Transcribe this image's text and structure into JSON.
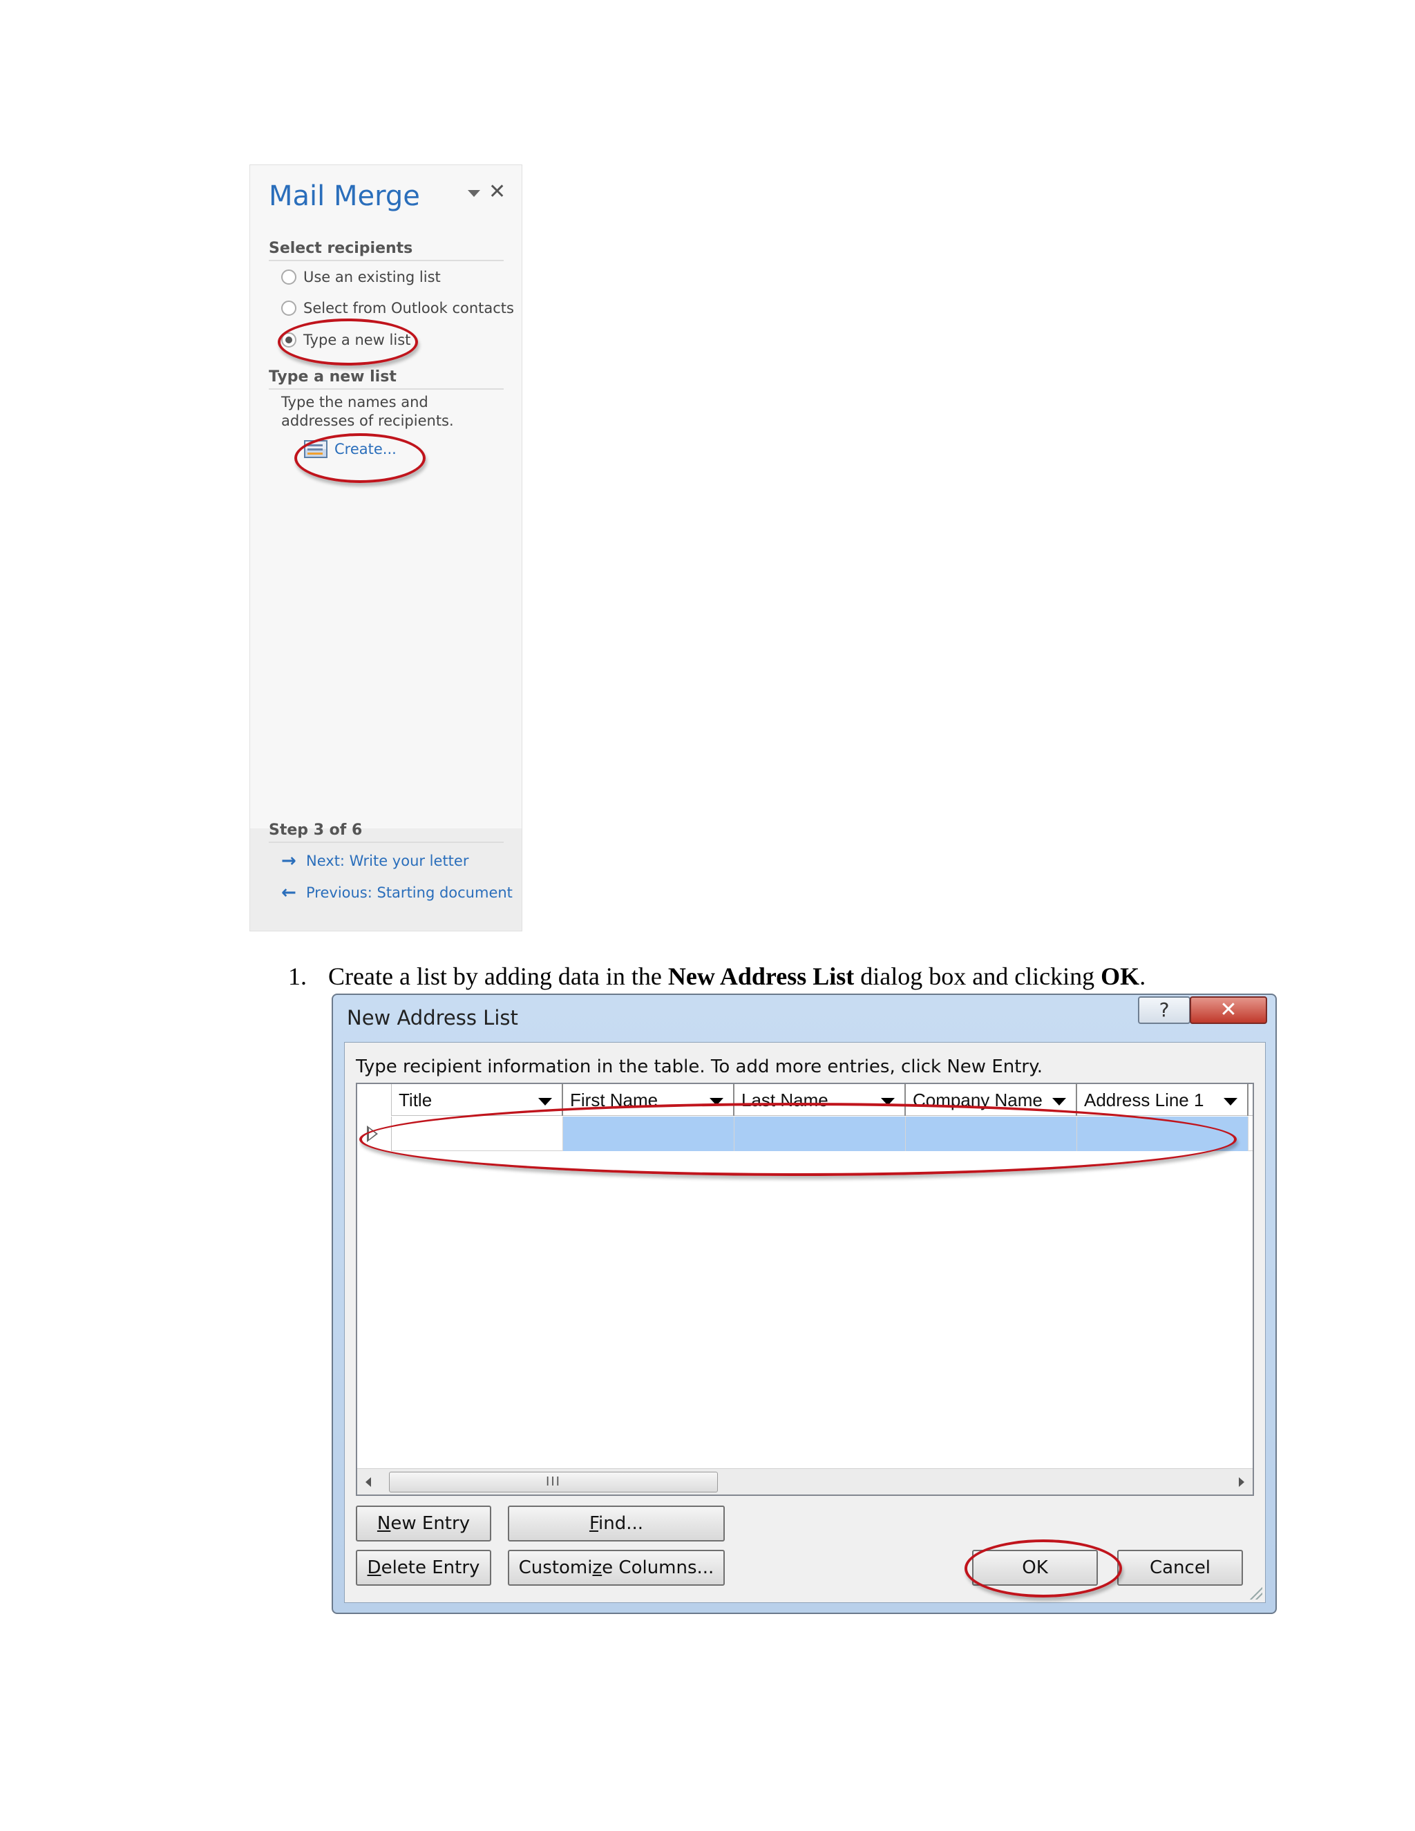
{
  "mail_merge_pane": {
    "title": "Mail Merge",
    "select_recipients_heading": "Select recipients",
    "options": [
      {
        "label": "Use an existing list",
        "checked": false
      },
      {
        "label": "Select from Outlook contacts",
        "checked": false
      },
      {
        "label": "Type a new list",
        "checked": true
      }
    ],
    "type_new_list_heading": "Type a new list",
    "description": "Type the names and addresses of recipients.",
    "create_link": "Create...",
    "step_heading": "Step 3 of 6",
    "next_link": "Next: Write your letter",
    "previous_link": "Previous: Starting document",
    "icons": {
      "menu": "chevron-down-icon",
      "close": "close-icon",
      "next": "arrow-right-icon",
      "previous": "arrow-left-icon"
    }
  },
  "instruction": {
    "number": "1.",
    "text_before": "Create a list by adding data in the ",
    "bold_1": "New Address List",
    "text_middle": " dialog box and clicking ",
    "bold_2": "OK",
    "text_after": "."
  },
  "dialog": {
    "title": "New Address List",
    "help_glyph": "?",
    "close_glyph": "✕",
    "instruction_text": "Type recipient information in the table.  To add more entries, click New Entry.",
    "columns": [
      "Title",
      "First Name",
      "Last Name",
      "Company Name",
      "Address Line 1"
    ],
    "scroll_thumb_glyph": "III",
    "buttons": {
      "new_entry": {
        "mnemonic": "N",
        "rest": "ew Entry"
      },
      "find": {
        "mnemonic": "F",
        "rest": "ind..."
      },
      "delete_entry": {
        "mnemonic": "D",
        "rest": "elete Entry"
      },
      "customize_pre": "Customi",
      "customize_mnemonic": "z",
      "customize_post": "e Columns...",
      "ok": "OK",
      "cancel": "Cancel"
    }
  },
  "colors": {
    "accent_blue": "#2a6ebb",
    "annotation_red": "#c0141c",
    "selection_blue": "#a9cdf5"
  }
}
